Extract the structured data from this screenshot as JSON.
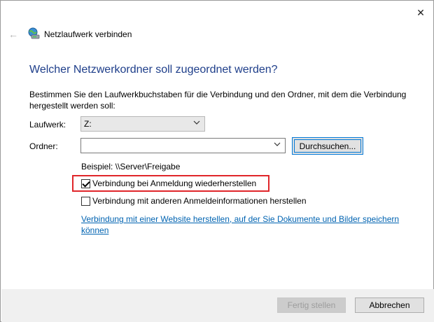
{
  "window": {
    "close_glyph": "✕"
  },
  "header": {
    "back_glyph": "←",
    "title": "Netzlaufwerk verbinden",
    "icon": "network-drive-icon"
  },
  "main": {
    "heading": "Welcher Netzwerkordner soll zugeordnet werden?",
    "description": "Bestimmen Sie den Laufwerkbuchstaben für die Verbindung und den Ordner, mit dem die Verbindung hergestellt werden soll:",
    "drive": {
      "label": "Laufwerk:",
      "value": "Z:"
    },
    "folder": {
      "label": "Ordner:",
      "value": "",
      "browse_label": "Durchsuchen..."
    },
    "example": "Beispiel: \\\\Server\\Freigabe",
    "checkbox_reconnect": {
      "label": "Verbindung bei Anmeldung wiederherstellen",
      "checked": true
    },
    "checkbox_other_credentials": {
      "label": "Verbindung mit anderen Anmeldeinformationen herstellen",
      "checked": false
    },
    "link": "Verbindung mit einer Website herstellen, auf der Sie Dokumente und Bilder speichern können"
  },
  "footer": {
    "finish_label": "Fertig stellen",
    "cancel_label": "Abbrechen"
  },
  "colors": {
    "heading": "#1e3e8a",
    "link": "#0063b1",
    "highlight": "#e0262a",
    "focus": "#0078d7"
  }
}
